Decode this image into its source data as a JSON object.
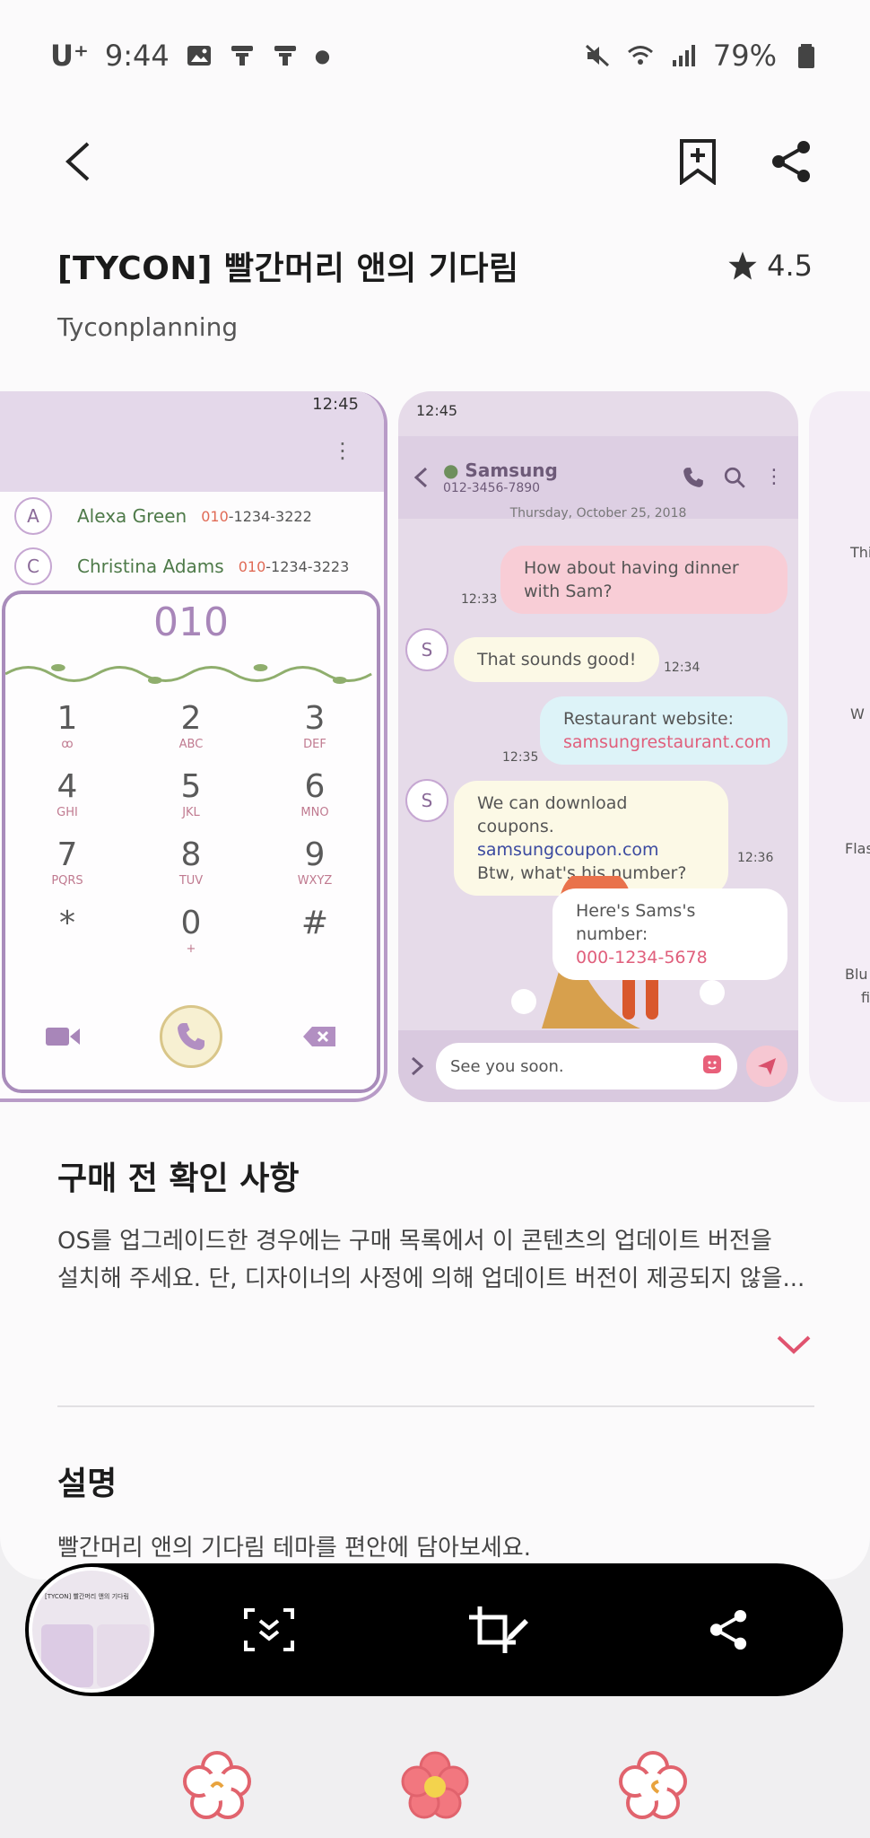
{
  "status_bar": {
    "carrier": "U⁺",
    "time": "9:44",
    "battery": "79%"
  },
  "app_bar": {
    "back_icon": "back-arrow-icon",
    "bookmark_icon": "bookmark-add-icon",
    "share_icon": "share-icon"
  },
  "theme": {
    "title": "[TYCON] 빨간머리 앤의 기다림",
    "rating": "4.5",
    "developer": "Tyconplanning"
  },
  "preview_contacts": {
    "time": "12:45",
    "contacts": [
      {
        "initial": "A",
        "name": "Alexa Green",
        "num_prefix": "010",
        "num_rest": "-1234-3222"
      },
      {
        "initial": "C",
        "name": "Christina Adams",
        "num_prefix": "010",
        "num_rest": "-1234-3223"
      }
    ],
    "dial_display": "010",
    "keys": [
      {
        "d": "1",
        "l": "ꝏ"
      },
      {
        "d": "2",
        "l": "ABC"
      },
      {
        "d": "3",
        "l": "DEF"
      },
      {
        "d": "4",
        "l": "GHI"
      },
      {
        "d": "5",
        "l": "JKL"
      },
      {
        "d": "6",
        "l": "MNO"
      },
      {
        "d": "7",
        "l": "PQRS"
      },
      {
        "d": "8",
        "l": "TUV"
      },
      {
        "d": "9",
        "l": "WXYZ"
      },
      {
        "d": "*",
        "l": ""
      },
      {
        "d": "0",
        "l": "+"
      },
      {
        "d": "#",
        "l": ""
      }
    ]
  },
  "preview_messages": {
    "time": "12:45",
    "contact_name": "Samsung",
    "contact_number": "012-3456-7890",
    "date": "Thursday, October 25, 2018",
    "messages": {
      "m1": "How about having dinner with Sam?",
      "m1_time": "12:33",
      "m2": "That sounds good!",
      "m2_time": "12:34",
      "m3_label": "Restaurant website:",
      "m3_link": "samsungrestaurant.com",
      "m3_time": "12:35",
      "m4_line1": "We can download coupons.",
      "m4_link": "samsungcoupon.com",
      "m4_line3": "Btw, what's his number?",
      "m4_time": "12:36",
      "m5_label": "Here's Sams's number:",
      "m5_link": "000-1234-5678"
    },
    "sender_initial": "S",
    "input_text": "See you soon."
  },
  "preview_third": {
    "fragments": [
      "Thi",
      "W",
      "Flas",
      "Blu",
      "fi"
    ]
  },
  "purchase_notice": {
    "heading": "구매 전 확인 사항",
    "line1": "OS를 업그레이드한 경우에는 구매 목록에서 이 콘텐츠의 업데이트 버전을",
    "line2": "설치해 주세요. 단, 디자이너의 사정에 의해 업데이트 버전이 제공되지 않을..."
  },
  "description": {
    "heading": "설명",
    "text": "빨간머리 앤의 기다림 테마를 편안에 담아보세요."
  },
  "screenshot_toolbar": {
    "thumbnail_title": "[TYCON] 빨간머리 앤의 기다림",
    "icons": [
      "scroll-capture-icon",
      "crop-edit-icon",
      "share-icon"
    ]
  },
  "colors": {
    "accent": "#e0536f",
    "lavender": "#e4d8ea",
    "toolbar": "#000000"
  }
}
